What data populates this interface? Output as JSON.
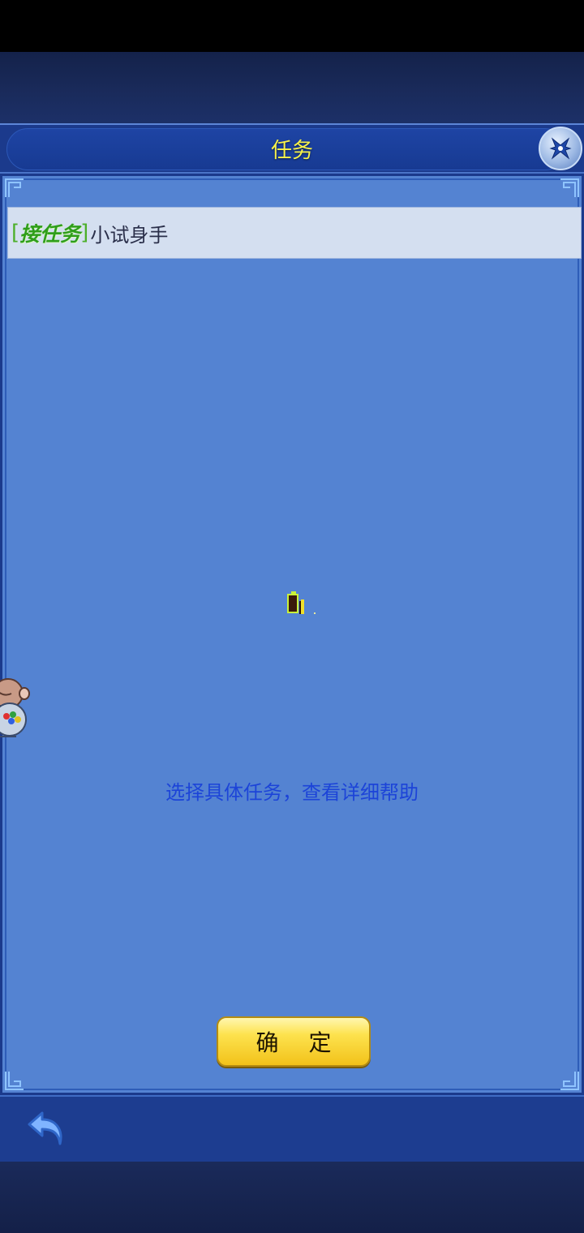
{
  "window": {
    "title": "任务"
  },
  "task_list": {
    "items": [
      {
        "tag_open": "[",
        "tag": "接任务",
        "tag_close": "]",
        "name": "小试身手"
      }
    ]
  },
  "detail": {
    "help_text": "选择具体任务，查看详细帮助"
  },
  "buttons": {
    "confirm_label": "确 定"
  },
  "icons": {
    "close": "close-icon",
    "back": "back-arrow-icon",
    "loading": "loading-icon",
    "mascot": "mascot-icon"
  },
  "colors": {
    "title_text": "#f7f24a",
    "panel_bg": "#5483d2",
    "tag_green": "#2f9e1a",
    "help_text": "#1c44d8",
    "confirm_bg": "#fde24e"
  }
}
